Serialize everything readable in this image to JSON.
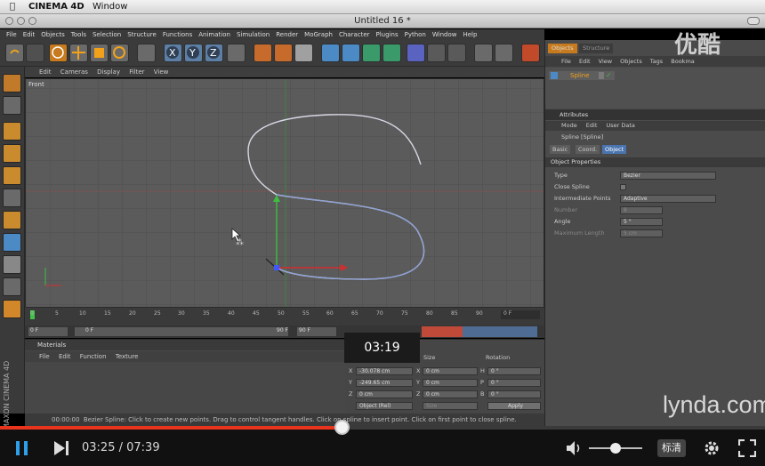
{
  "mac_menu": {
    "apple": "",
    "app": "CINEMA 4D",
    "window": "Window"
  },
  "window_title": "Untitled 16 *",
  "menu_items": [
    "File",
    "Edit",
    "Objects",
    "Tools",
    "Selection",
    "Structure",
    "Functions",
    "Animation",
    "Simulation",
    "Render",
    "MoGraph",
    "Character",
    "Plugins",
    "Python",
    "Window",
    "Help"
  ],
  "viewport_menu": [
    "Edit",
    "Cameras",
    "Display",
    "Filter",
    "View"
  ],
  "viewport_label": "Front",
  "timeline": {
    "ticks": [
      "0",
      "5",
      "10",
      "15",
      "20",
      "25",
      "30",
      "35",
      "40",
      "45",
      "50",
      "55",
      "60",
      "65",
      "70",
      "75",
      "80",
      "85",
      "90"
    ],
    "end": "0 F"
  },
  "transport": {
    "start": "0 F",
    "current": "0 F",
    "min": "90 F",
    "max": "90 F"
  },
  "materials": {
    "title": "Materials",
    "menu": [
      "File",
      "Edit",
      "Function",
      "Texture"
    ]
  },
  "coords": {
    "headers": {
      "position": "",
      "size": "Size",
      "rotation": "Rotation"
    },
    "rows": [
      {
        "axis": "X",
        "pos": "-30.078 cm",
        "size": "0 cm",
        "rlabel": "H",
        "rot": "0 °"
      },
      {
        "axis": "Y",
        "pos": "-249.65 cm",
        "size": "0 cm",
        "rlabel": "P",
        "rot": "0 °"
      },
      {
        "axis": "Z",
        "pos": "0 cm",
        "size": "0 cm",
        "rlabel": "B",
        "rot": "0 °"
      }
    ],
    "mode": "Object (Rel)",
    "size_mode": "Size",
    "apply": "Apply"
  },
  "status": {
    "time": "00:00:00",
    "text": "Bezier Spline: Click to create new points. Drag to control tangent handles. Click on spline to insert point. Click on first point to close spline."
  },
  "right_panel": {
    "tabs": [
      "Objects",
      "Structure"
    ],
    "menu": [
      "File",
      "Edit",
      "View",
      "Objects",
      "Tags",
      "Bookma"
    ],
    "object_name": "Spline"
  },
  "attributes": {
    "title": "Attributes",
    "menu": [
      "Mode",
      "Edit",
      "User Data"
    ],
    "object": "Spline [Spline]",
    "tabs": [
      "Basic",
      "Coord.",
      "Object"
    ],
    "section": "Object Properties",
    "props": [
      {
        "label": "Type",
        "value": "Bezier"
      },
      {
        "label": "Close Spline",
        "value": ""
      },
      {
        "label": "Intermediate Points",
        "value": "Adaptive"
      },
      {
        "label": "Number",
        "value": "8"
      },
      {
        "label": "Angle",
        "value": "5 °"
      },
      {
        "label": "Maximum Length",
        "value": "5 cm"
      }
    ]
  },
  "player": {
    "current": "03:25",
    "total": "07:39",
    "separator": " / ",
    "quality": "标清",
    "tooltip": "03:19",
    "progress": 0.447
  },
  "watermarks": {
    "youku": "优酷",
    "lynda": "lynda.com",
    "maxon": "MAXON CINEMA 4D"
  }
}
